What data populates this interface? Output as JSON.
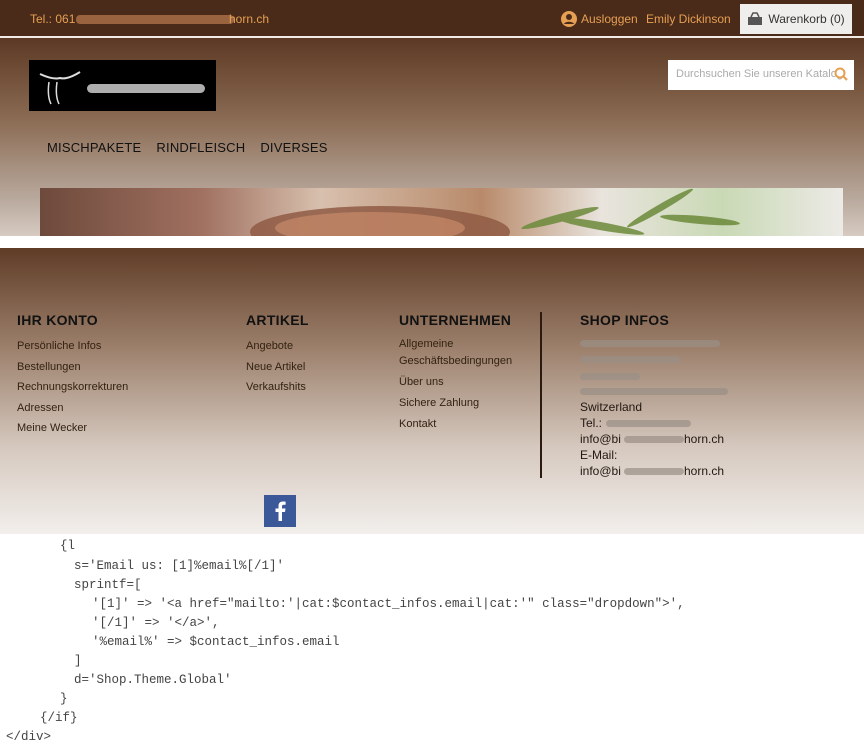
{
  "topbar": {
    "phone_prefix": "Tel.: 061",
    "phone_suffix": "horn.ch",
    "logout": "Ausloggen",
    "user": "Emily Dickinson",
    "cart": "Warenkorb (0)"
  },
  "header": {
    "search_placeholder": "Durchsuchen Sie unseren Katalog",
    "nav": [
      "MISCHPAKETE",
      "RINDFLEISCH",
      "DIVERSES"
    ]
  },
  "footer": {
    "konto": {
      "title": "IHR KONTO",
      "items": [
        "Persönliche Infos",
        "Bestellungen",
        "Rechnungskorrekturen",
        "Adressen",
        "Meine Wecker"
      ]
    },
    "artikel": {
      "title": "ARTIKEL",
      "items": [
        "Angebote",
        "Neue Artikel",
        "Verkaufshits"
      ]
    },
    "unternehmen": {
      "title": "UNTERNEHMEN",
      "items": [
        "Allgemeine Geschäftsbedingungen",
        "Über uns",
        "Sichere Zahlung",
        "Kontakt"
      ]
    },
    "shop": {
      "title": "SHOP INFOS",
      "country": "Switzerland",
      "tel_label": "Tel.:",
      "email1_prefix": "info@bi",
      "email1_suffix": "horn.ch",
      "email_label": "E-Mail:",
      "email2_prefix": "info@bi",
      "email2_suffix": "horn.ch"
    }
  },
  "code": [
    "{l",
    "s='Email us: [1]%email%[/1]'",
    "sprintf=[",
    "'[1]' => '<a href=\"mailto:'|cat:$contact_infos.email|cat:'\" class=\"dropdown\">',",
    "'[/1]' => '</a>',",
    "'%email%' => $contact_infos.email",
    "]",
    "d='Shop.Theme.Global'",
    "}",
    "{/if}",
    "</div>"
  ]
}
